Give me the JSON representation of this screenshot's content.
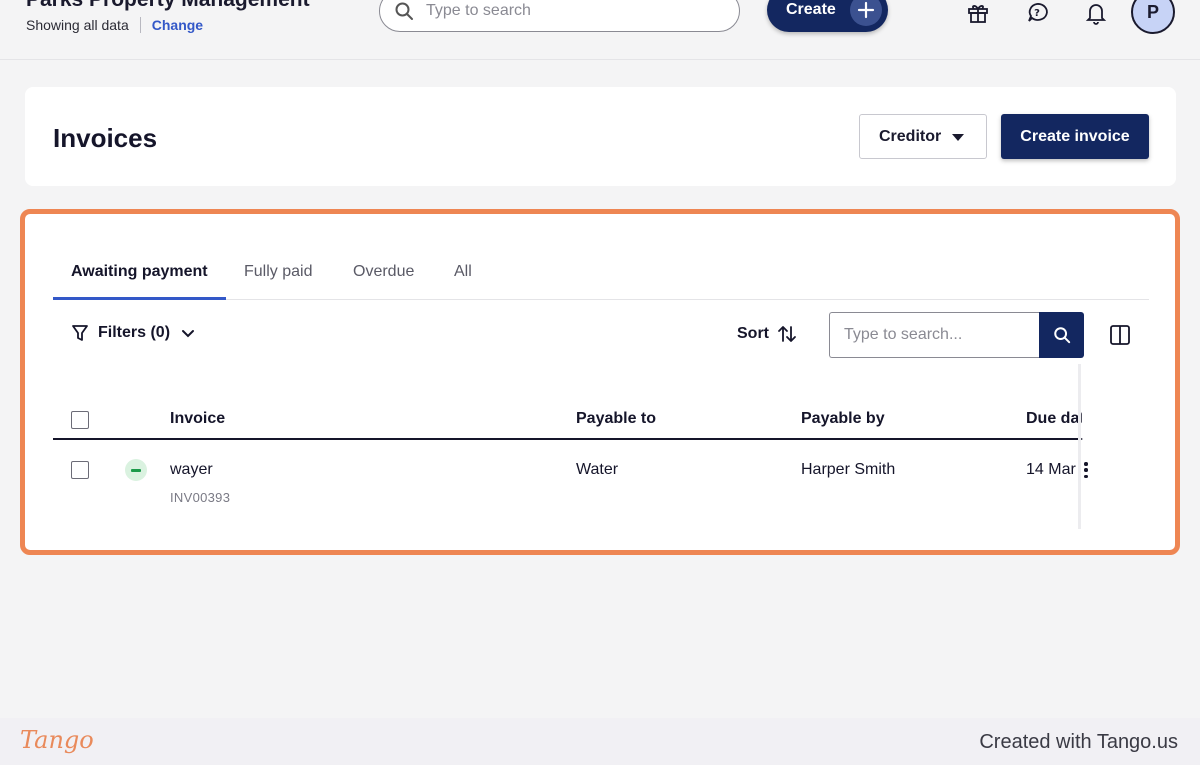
{
  "header": {
    "org_name": "Parks Property Management",
    "showing_text": "Showing all data",
    "change_link": "Change",
    "search_placeholder": "Type to search",
    "create_label": "Create",
    "avatar_initial": "P"
  },
  "page": {
    "title": "Invoices",
    "creditor_label": "Creditor",
    "create_invoice_label": "Create invoice"
  },
  "tabs": [
    {
      "label": "Awaiting payment",
      "active": true
    },
    {
      "label": "Fully paid",
      "active": false
    },
    {
      "label": "Overdue",
      "active": false
    },
    {
      "label": "All",
      "active": false
    }
  ],
  "toolbar": {
    "filters_label": "Filters (0)",
    "sort_label": "Sort",
    "search_placeholder": "Type to search..."
  },
  "table": {
    "columns": [
      "Invoice",
      "Payable to",
      "Payable by",
      "Due date"
    ],
    "rows": [
      {
        "invoice": "wayer",
        "invoice_number": "INV00393",
        "payable_to": "Water",
        "payable_by": "Harper Smith",
        "due_date": "14 Mar"
      }
    ]
  },
  "footer": {
    "logo_text": "Tango",
    "created_with": "Created with Tango.us"
  },
  "colors": {
    "navy": "#132760",
    "highlight": "#ee8653",
    "link": "#3358c8",
    "status_green": "#1c9a4a"
  }
}
